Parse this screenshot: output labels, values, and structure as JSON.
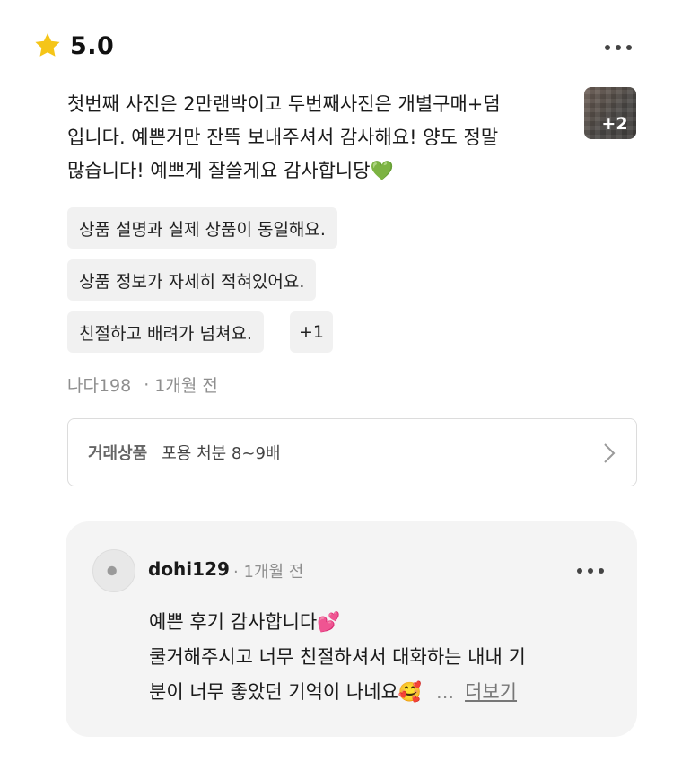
{
  "rating": {
    "value": "5.0",
    "star_color": "#f5c518"
  },
  "review": {
    "text": "첫번째 사진은 2만랜박이고 두번째사진은 개별구매+덤 입니다. 예쁜거만 잔뜩 보내주셔서 감사해요! 양도 정말 많습니다! 예쁘게 잘쓸게요 감사합니당💚",
    "photo_more_count": "+2",
    "chips": [
      "상품 설명과 실제 상품이 동일해요.",
      "상품 정보가 자세히 적혀있어요.",
      "친절하고 배려가 넘쳐요."
    ],
    "chips_more": "+1",
    "author": "나다198",
    "time": "1개월 전"
  },
  "product": {
    "label": "거래상품",
    "name": "포용 처분 8~9배"
  },
  "reply": {
    "author": "dohi129",
    "time": "1개월 전",
    "lines": [
      "예쁜 후기 감사합니다💕",
      "쿨거해주시고 너무 친절하셔서 대화하는 내내 기",
      "분이 너무 좋았던 기억이 나네요🥰"
    ],
    "ellipsis": "...",
    "more_label": "더보기"
  }
}
